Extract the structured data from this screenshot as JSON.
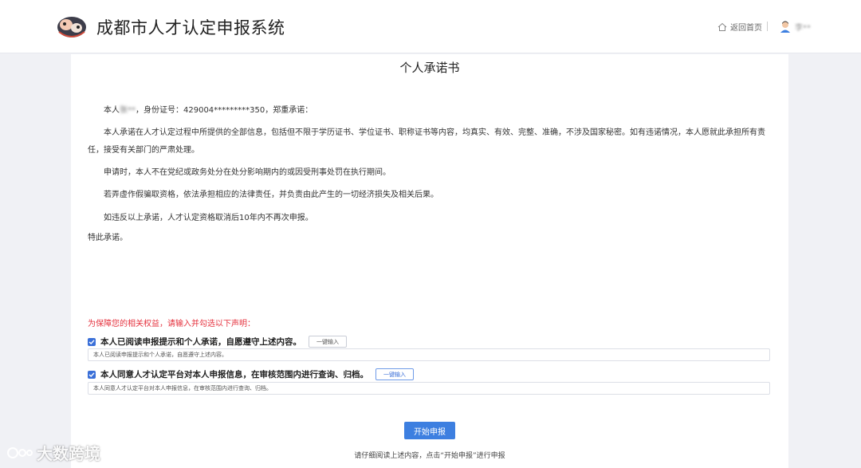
{
  "header": {
    "site_title": "成都市人才认定申报系统",
    "home_link": "返回首页",
    "username": "李**"
  },
  "document": {
    "title": "个人承诺书",
    "name_prefix": "本人",
    "name_masked": "张**",
    "id_statement": "，身份证号：429004*********350，郑重承诺：",
    "para1": "本人承诺在人才认定过程中所提供的全部信息，包括但不限于学历证书、学位证书、职称证书等内容，均真实、有效、完整、准确，不涉及国家秘密。如有违诺情况，本人愿就此承担所有责任，接受有关部门的严肃处理。",
    "para2": "申请时，本人不在党纪或政务处分在处分影响期内的或因受刑事处罚在执行期间。",
    "para3": "若弄虚作假骗取资格，依法承担相应的法律责任，并负责由此产生的一切经济损失及相关后果。",
    "para4": "如违反以上承诺，人才认定资格取消后10年内不再次申报。",
    "closing": "特此承诺。"
  },
  "declaration": {
    "notice": "为保障您的相关权益，请输入并勾选以下声明：",
    "items": [
      {
        "label": "本人已阅读申报提示和个人承诺，自愿遵守上述内容。",
        "button": "一键输入",
        "input_value": "本人已阅读申报提示和个人承诺，自愿遵守上述内容。",
        "checked": true
      },
      {
        "label": "本人同意人才认定平台对本人申报信息，在审核范围内进行查询、归档。",
        "button": "一键输入",
        "input_value": "本人同意人才认定平台对本人申报信息，在审核范围内进行查询、归档。",
        "checked": true
      }
    ]
  },
  "actions": {
    "start_button": "开始申报",
    "hint": "请仔细阅读上述内容，点击“开始申报”进行申报"
  },
  "watermark": {
    "text": "大数跨境"
  },
  "colors": {
    "primary": "#3d7fe0",
    "notice_red": "#e5323e",
    "page_bg": "#f0f1f5"
  }
}
